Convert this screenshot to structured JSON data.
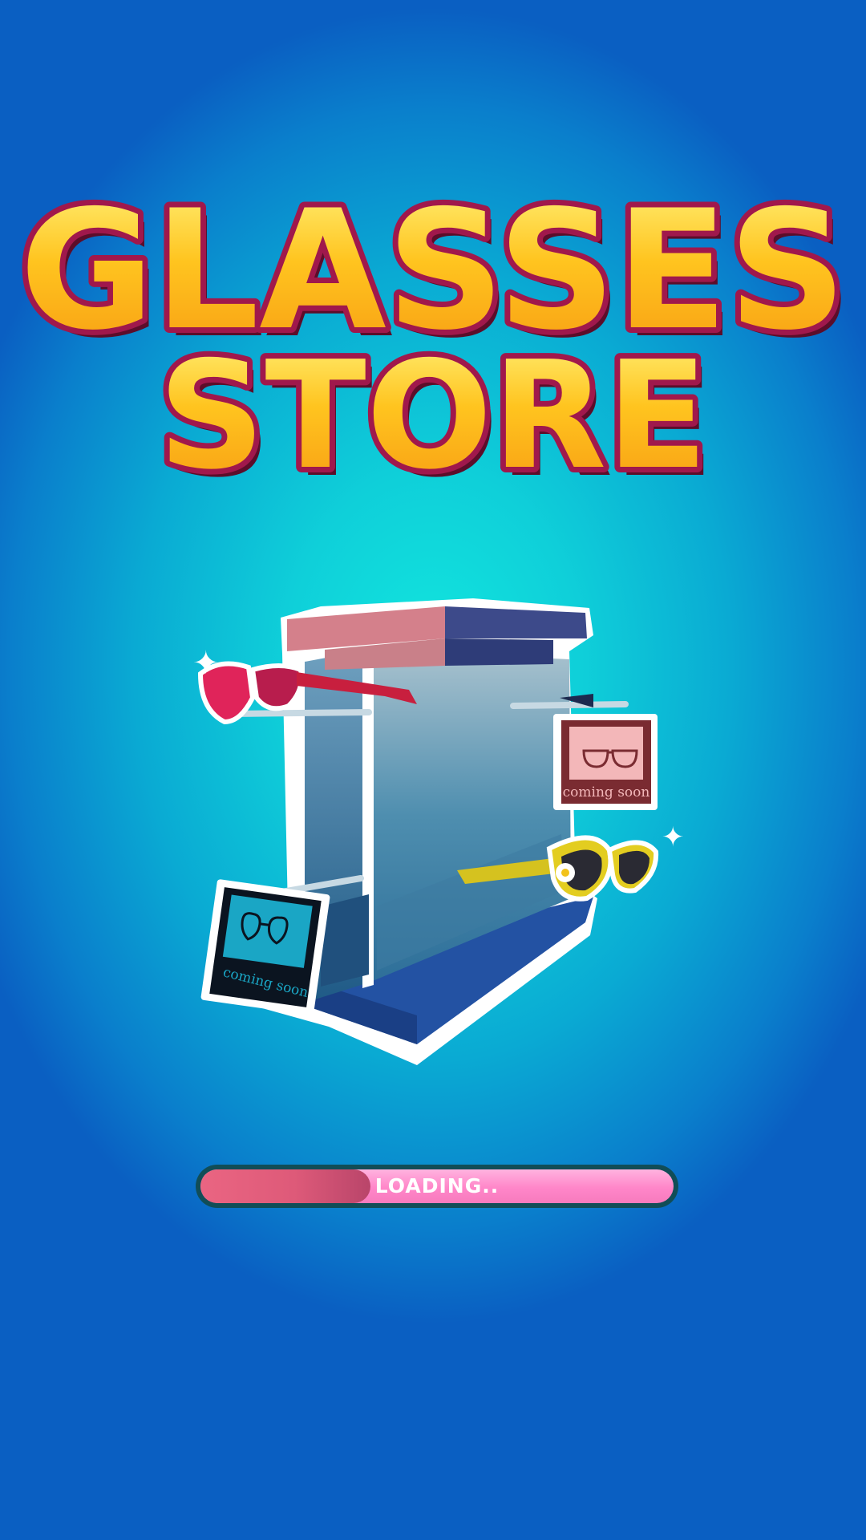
{
  "title": {
    "line1": "GLASSES",
    "line2": "STORE"
  },
  "stand": {
    "sign_left_text": "coming soon",
    "sign_right_text": "coming soon"
  },
  "loading": {
    "label": "LOADING..",
    "progress": 0.36
  },
  "colors": {
    "title_fill": "#ffc21f",
    "title_outline": "#a0184c",
    "bar_fill": "#e0607e",
    "bar_track": "#ff8fcc"
  }
}
